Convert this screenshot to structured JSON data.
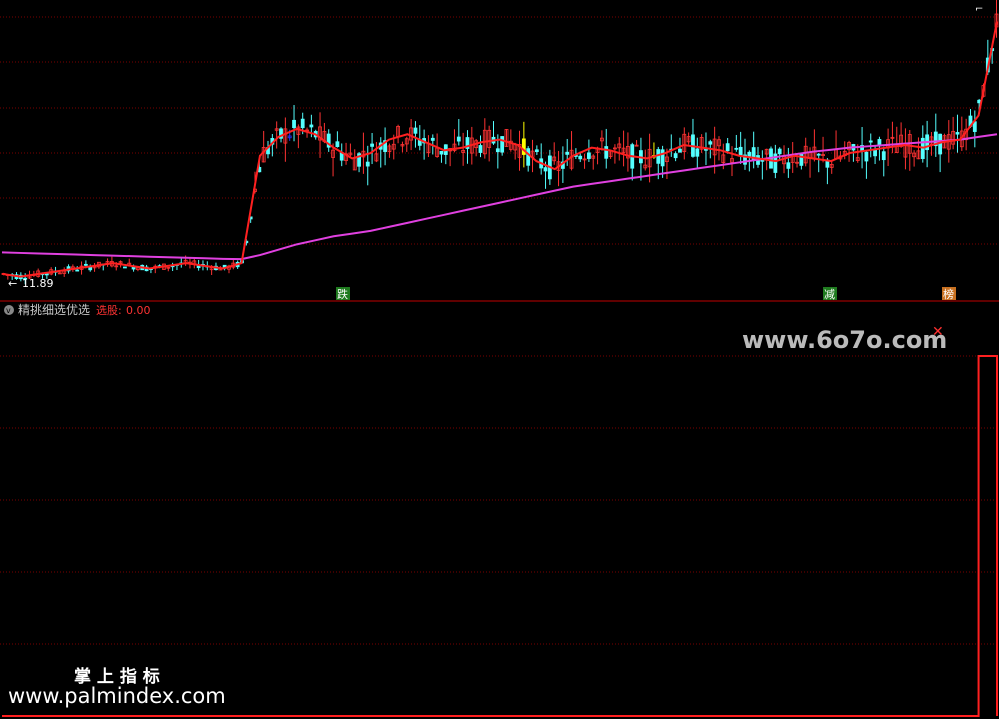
{
  "upper_panel": {
    "low_price_label": "11.89",
    "signal_tags": [
      {
        "text": "跌",
        "bg": "#1e7a1e"
      },
      {
        "text": "减",
        "bg": "#1e7a1e"
      },
      {
        "text": "榜",
        "bg": "#c87020"
      }
    ],
    "colors": {
      "up": "#ff3333",
      "down": "#54ffff",
      "ma_short": "#ff2020",
      "ma_long": "#e040e0",
      "highlight_yellow": "#ffff00",
      "highlight_blue": "#2233ff"
    }
  },
  "lower_panel": {
    "indicator_name": "精挑细选优选",
    "output_label": "选股:",
    "output_value": "0.00",
    "colors": {
      "line": "#ff2020",
      "label": "#ff3333",
      "name": "#c8c8c8"
    }
  },
  "watermarks": {
    "site_url": "www.6o7o.com",
    "brand_cn": "掌 上 指 标",
    "brand_url": "www.palmindex.com"
  },
  "chart_data": [
    {
      "type": "line",
      "title": "",
      "series": [
        {
          "values": [
            12.1,
            12.0,
            12.1,
            12.2,
            12.3,
            12.4,
            12.5,
            12.4,
            12.3,
            12.4,
            12.5,
            12.4,
            12.3,
            12.5,
            16.5,
            17.2,
            17.5,
            17.3,
            16.8,
            16.4,
            16.6,
            17.1,
            17.3,
            17.0,
            16.7,
            16.8,
            17.0,
            17.1,
            16.9,
            16.3,
            16.0,
            16.5,
            16.8,
            16.7,
            16.5,
            16.4,
            16.6,
            16.9,
            16.8,
            16.7,
            16.5,
            16.4,
            16.3,
            16.5,
            16.4,
            16.3,
            16.6,
            16.7,
            16.8,
            16.9,
            16.8,
            17.0,
            17.1,
            18.0,
            21.5
          ]
        },
        {
          "values": [
            12.9,
            12.88,
            12.86,
            12.84,
            12.82,
            12.8,
            12.78,
            12.76,
            12.74,
            12.72,
            12.7,
            12.68,
            12.66,
            12.65,
            12.8,
            13.0,
            13.2,
            13.35,
            13.5,
            13.6,
            13.7,
            13.85,
            14.0,
            14.15,
            14.3,
            14.45,
            14.6,
            14.75,
            14.9,
            15.05,
            15.2,
            15.35,
            15.45,
            15.55,
            15.65,
            15.75,
            15.85,
            15.95,
            16.05,
            16.15,
            16.25,
            16.35,
            16.45,
            16.55,
            16.65,
            16.72,
            16.8,
            16.85,
            16.9,
            16.95,
            17.0,
            17.05,
            17.1,
            17.2,
            17.3
          ]
        }
      ]
    },
    {
      "type": "line",
      "title": "",
      "series": [
        {
          "values": [
            0,
            0,
            0,
            0,
            0,
            0,
            0,
            0,
            0,
            0,
            0,
            0,
            0,
            0,
            0,
            0,
            0,
            0,
            0,
            0,
            0,
            0,
            0,
            0,
            0,
            0,
            0,
            0,
            0,
            0,
            0,
            0,
            0,
            0,
            0,
            0,
            0,
            0,
            0,
            0,
            0,
            0,
            0,
            0,
            0,
            0,
            0,
            0,
            0,
            0,
            0,
            0,
            0,
            1,
            0
          ]
        }
      ]
    }
  ]
}
